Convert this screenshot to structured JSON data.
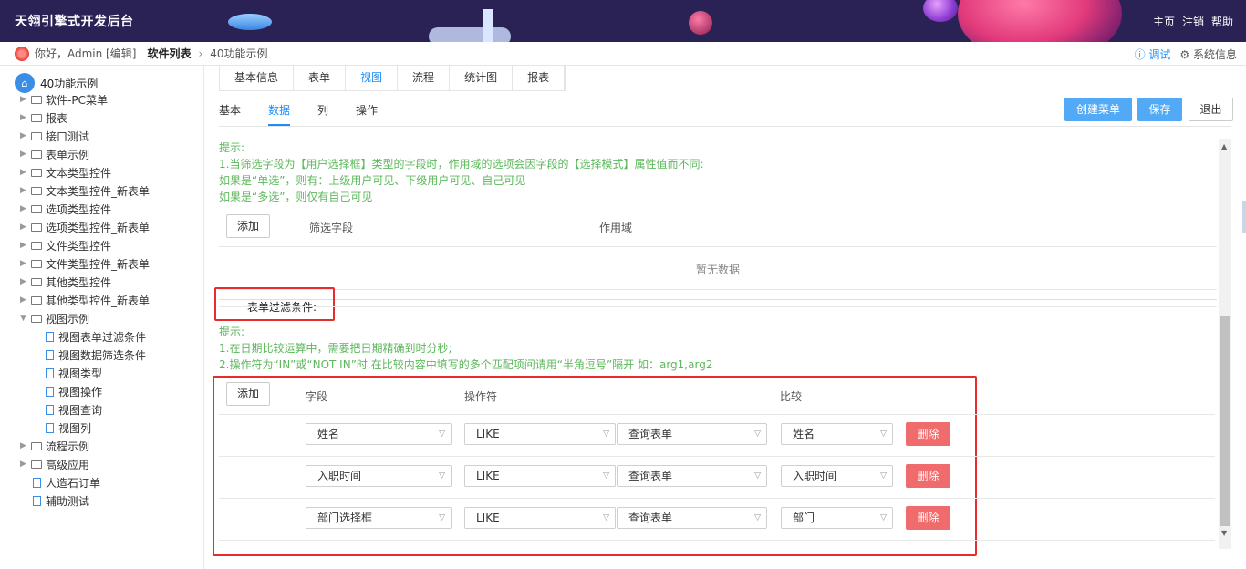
{
  "header": {
    "title": "天翎引擎式开发后台",
    "nav": [
      "主页",
      "注销",
      "帮助"
    ]
  },
  "crumbs": {
    "greeting": "你好，Admin [编辑]",
    "software_list": "软件列表",
    "separator": "›",
    "current": "40功能示例",
    "debug": "ⓘ 调试",
    "system_info": "⚙ 系统信息"
  },
  "sidebar": {
    "root": "40功能示例",
    "items": [
      {
        "label": "软件-PC菜单",
        "type": "folder"
      },
      {
        "label": "报表",
        "type": "folder"
      },
      {
        "label": "接口测试",
        "type": "folder"
      },
      {
        "label": "表单示例",
        "type": "folder"
      },
      {
        "label": "文本类型控件",
        "type": "folder"
      },
      {
        "label": "文本类型控件_新表单",
        "type": "folder"
      },
      {
        "label": "选项类型控件",
        "type": "folder"
      },
      {
        "label": "选项类型控件_新表单",
        "type": "folder"
      },
      {
        "label": "文件类型控件",
        "type": "folder"
      },
      {
        "label": "文件类型控件_新表单",
        "type": "folder"
      },
      {
        "label": "其他类型控件",
        "type": "folder"
      },
      {
        "label": "其他类型控件_新表单",
        "type": "folder"
      },
      {
        "label": "视图示例",
        "type": "folder-open"
      },
      {
        "label": "视图表单过滤条件",
        "type": "doc"
      },
      {
        "label": "视图数据筛选条件",
        "type": "doc"
      },
      {
        "label": "视图类型",
        "type": "doc"
      },
      {
        "label": "视图操作",
        "type": "doc"
      },
      {
        "label": "视图查询",
        "type": "doc"
      },
      {
        "label": "视图列",
        "type": "doc"
      },
      {
        "label": "流程示例",
        "type": "folder"
      },
      {
        "label": "高级应用",
        "type": "folder"
      },
      {
        "label": "人造石订单",
        "type": "doc"
      },
      {
        "label": "辅助测试",
        "type": "doc"
      }
    ]
  },
  "tabs": [
    "基本信息",
    "表单",
    "视图",
    "流程",
    "统计图",
    "报表"
  ],
  "active_tab": "视图",
  "subtabs": [
    "基本",
    "数据",
    "列",
    "操作"
  ],
  "active_subtab": "数据",
  "buttons": {
    "create_menu": "创建菜单",
    "save": "保存",
    "exit": "退出"
  },
  "hint1": {
    "title": "提示:",
    "line1": "1.当筛选字段为【用户选择框】类型的字段时，作用域的选项会因字段的【选择模式】属性值而不同:",
    "line2": "如果是“单选”，则有：上级用户可见、下级用户可见、自己可见",
    "line3": "如果是“多选”，则仅有自己可见"
  },
  "filter_table": {
    "add": "添加",
    "col_field": "筛选字段",
    "col_scope": "作用域",
    "empty": "暂无数据"
  },
  "form_filter": {
    "legend": "表单过滤条件:",
    "hint_title": "提示:",
    "hint_line1": "1.在日期比较运算中，需要把日期精确到时分秒;",
    "hint_line2": "2.操作符为“IN”或“NOT IN”时,在比较内容中填写的多个匹配项间请用“半角逗号”隔开 如：arg1,arg2",
    "add": "添加",
    "col_field": "字段",
    "col_operator": "操作符",
    "col_compare": "比较",
    "delete": "删除",
    "rows": [
      {
        "field": "姓名",
        "operator": "LIKE",
        "source": "查询表单",
        "compare": "姓名"
      },
      {
        "field": "入职时间",
        "operator": "LIKE",
        "source": "查询表单",
        "compare": "入职时间"
      },
      {
        "field": "部门选择框",
        "operator": "LIKE",
        "source": "查询表单",
        "compare": "部门"
      }
    ]
  },
  "colors": {
    "primary": "#52a9f5",
    "danger": "#f06c6c",
    "hint": "#5cb85c",
    "highlight": "#e82b2b",
    "topbar": "#2a2155"
  }
}
